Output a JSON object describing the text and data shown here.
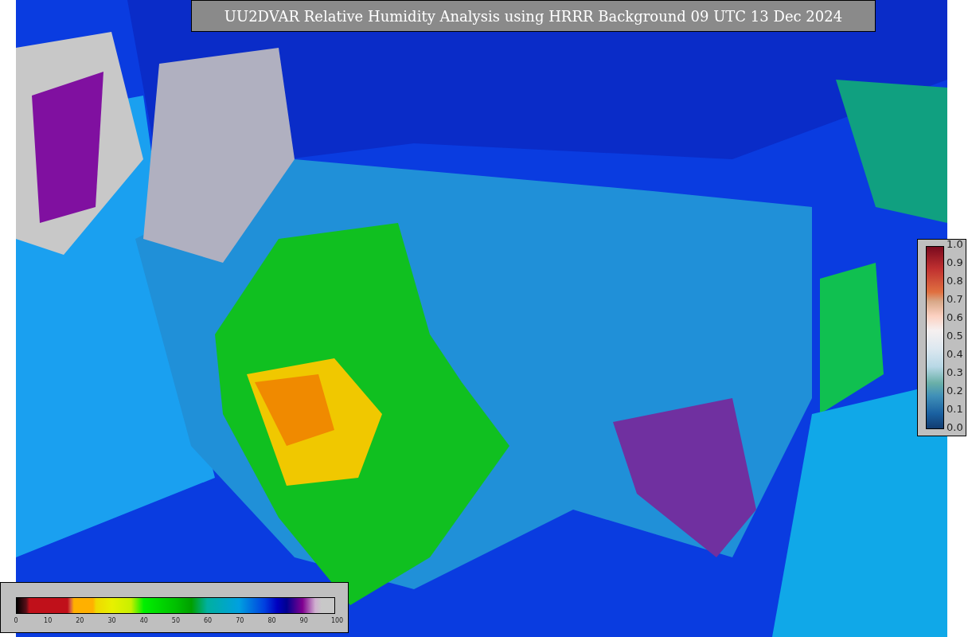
{
  "title": "UU2DVAR Relative Humidity Analysis using HRRR Background 09 UTC 13 Dec 2024",
  "right_colorbar": {
    "ticks": [
      "1.0",
      "0.9",
      "0.8",
      "0.7",
      "0.6",
      "0.5",
      "0.4",
      "0.3",
      "0.2",
      "0.1",
      "0.0"
    ]
  },
  "bottom_colorbar": {
    "ticks": [
      "0",
      "10",
      "20",
      "30",
      "40",
      "50",
      "60",
      "70",
      "80",
      "90",
      "100"
    ]
  }
}
